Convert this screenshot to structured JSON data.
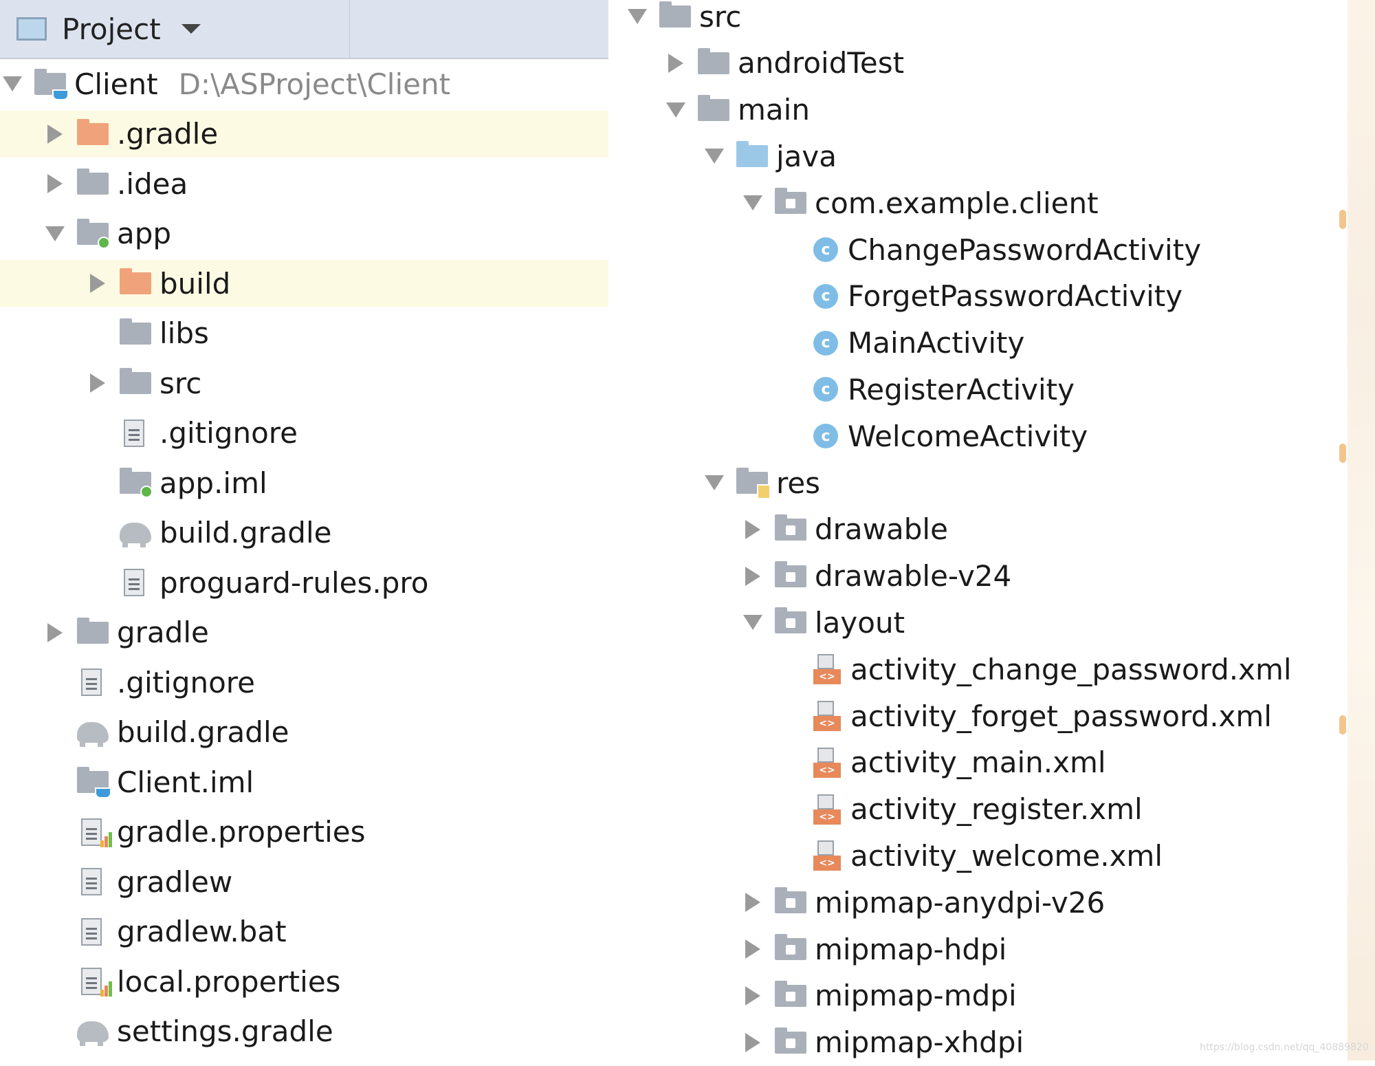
{
  "header": {
    "title": "Project",
    "caret": "chevron-down-icon"
  },
  "left_tree": [
    {
      "indent": 0,
      "arrow": "down",
      "icon": "module-folder-icon",
      "label": "Client",
      "path": "D:\\ASProject\\Client",
      "highlight": false
    },
    {
      "indent": 1,
      "arrow": "right",
      "icon": "folder-orange-icon",
      "label": ".gradle",
      "highlight": true
    },
    {
      "indent": 1,
      "arrow": "right",
      "icon": "folder-icon",
      "label": ".idea",
      "highlight": false
    },
    {
      "indent": 1,
      "arrow": "down",
      "icon": "module-folder-app-icon",
      "label": "app",
      "highlight": false
    },
    {
      "indent": 2,
      "arrow": "right",
      "icon": "folder-orange-icon",
      "label": "build",
      "highlight": true
    },
    {
      "indent": 2,
      "arrow": "none",
      "icon": "folder-icon",
      "label": "libs",
      "highlight": false
    },
    {
      "indent": 2,
      "arrow": "right",
      "icon": "folder-icon",
      "label": "src",
      "highlight": false
    },
    {
      "indent": 2,
      "arrow": "none",
      "icon": "text-file-icon",
      "label": ".gitignore",
      "highlight": false
    },
    {
      "indent": 2,
      "arrow": "none",
      "icon": "module-file-icon",
      "label": "app.iml",
      "highlight": false
    },
    {
      "indent": 2,
      "arrow": "none",
      "icon": "gradle-elephant-icon",
      "label": "build.gradle",
      "highlight": false
    },
    {
      "indent": 2,
      "arrow": "none",
      "icon": "text-file-icon",
      "label": "proguard-rules.pro",
      "highlight": false
    },
    {
      "indent": 1,
      "arrow": "right",
      "icon": "folder-icon",
      "label": "gradle",
      "highlight": false
    },
    {
      "indent": 1,
      "arrow": "none",
      "icon": "text-file-icon",
      "label": ".gitignore",
      "highlight": false
    },
    {
      "indent": 1,
      "arrow": "none",
      "icon": "gradle-elephant-icon",
      "label": "build.gradle",
      "highlight": false
    },
    {
      "indent": 1,
      "arrow": "none",
      "icon": "module-file-client-icon",
      "label": "Client.iml",
      "highlight": false
    },
    {
      "indent": 1,
      "arrow": "none",
      "icon": "properties-file-icon",
      "label": "gradle.properties",
      "highlight": false
    },
    {
      "indent": 1,
      "arrow": "none",
      "icon": "text-file-icon",
      "label": "gradlew",
      "highlight": false
    },
    {
      "indent": 1,
      "arrow": "none",
      "icon": "text-file-icon",
      "label": "gradlew.bat",
      "highlight": false
    },
    {
      "indent": 1,
      "arrow": "none",
      "icon": "properties-file-icon",
      "label": "local.properties",
      "highlight": false
    },
    {
      "indent": 1,
      "arrow": "none",
      "icon": "gradle-elephant-icon",
      "label": "settings.gradle",
      "highlight": false
    }
  ],
  "right_tree": [
    {
      "indent": 0,
      "arrow": "down",
      "icon": "folder-icon",
      "label": "src"
    },
    {
      "indent": 1,
      "arrow": "right",
      "icon": "folder-icon",
      "label": "androidTest"
    },
    {
      "indent": 1,
      "arrow": "down",
      "icon": "folder-icon",
      "label": "main"
    },
    {
      "indent": 2,
      "arrow": "down",
      "icon": "source-folder-icon",
      "label": "java"
    },
    {
      "indent": 3,
      "arrow": "down",
      "icon": "package-icon",
      "label": "com.example.client"
    },
    {
      "indent": 4,
      "arrow": "none",
      "icon": "class-icon",
      "label": "ChangePasswordActivity"
    },
    {
      "indent": 4,
      "arrow": "none",
      "icon": "class-icon",
      "label": "ForgetPasswordActivity"
    },
    {
      "indent": 4,
      "arrow": "none",
      "icon": "class-icon",
      "label": "MainActivity"
    },
    {
      "indent": 4,
      "arrow": "none",
      "icon": "class-icon",
      "label": "RegisterActivity"
    },
    {
      "indent": 4,
      "arrow": "none",
      "icon": "class-icon",
      "label": "WelcomeActivity"
    },
    {
      "indent": 2,
      "arrow": "down",
      "icon": "resources-folder-icon",
      "label": "res"
    },
    {
      "indent": 3,
      "arrow": "right",
      "icon": "package-icon",
      "label": "drawable"
    },
    {
      "indent": 3,
      "arrow": "right",
      "icon": "package-icon",
      "label": "drawable-v24"
    },
    {
      "indent": 3,
      "arrow": "down",
      "icon": "package-icon",
      "label": "layout"
    },
    {
      "indent": 4,
      "arrow": "none",
      "icon": "xml-file-icon",
      "label": "activity_change_password.xml"
    },
    {
      "indent": 4,
      "arrow": "none",
      "icon": "xml-file-icon",
      "label": "activity_forget_password.xml"
    },
    {
      "indent": 4,
      "arrow": "none",
      "icon": "xml-file-icon",
      "label": "activity_main.xml"
    },
    {
      "indent": 4,
      "arrow": "none",
      "icon": "xml-file-icon",
      "label": "activity_register.xml"
    },
    {
      "indent": 4,
      "arrow": "none",
      "icon": "xml-file-icon",
      "label": "activity_welcome.xml"
    },
    {
      "indent": 3,
      "arrow": "right",
      "icon": "package-icon",
      "label": "mipmap-anydpi-v26"
    },
    {
      "indent": 3,
      "arrow": "right",
      "icon": "package-icon",
      "label": "mipmap-hdpi"
    },
    {
      "indent": 3,
      "arrow": "right",
      "icon": "package-icon",
      "label": "mipmap-mdpi"
    },
    {
      "indent": 3,
      "arrow": "right",
      "icon": "package-icon",
      "label": "mipmap-xhdpi"
    }
  ],
  "watermark": "https://blog.csdn.net/qq_40889820",
  "colors": {
    "header_bg": "#dde3ee",
    "highlight_row": "#fdfae3",
    "folder_gray": "#a9b0b9",
    "folder_orange": "#f0a37a",
    "folder_blue": "#9cc8e8",
    "class_icon": "#7fbde6",
    "xml_tag": "#e7895a"
  }
}
